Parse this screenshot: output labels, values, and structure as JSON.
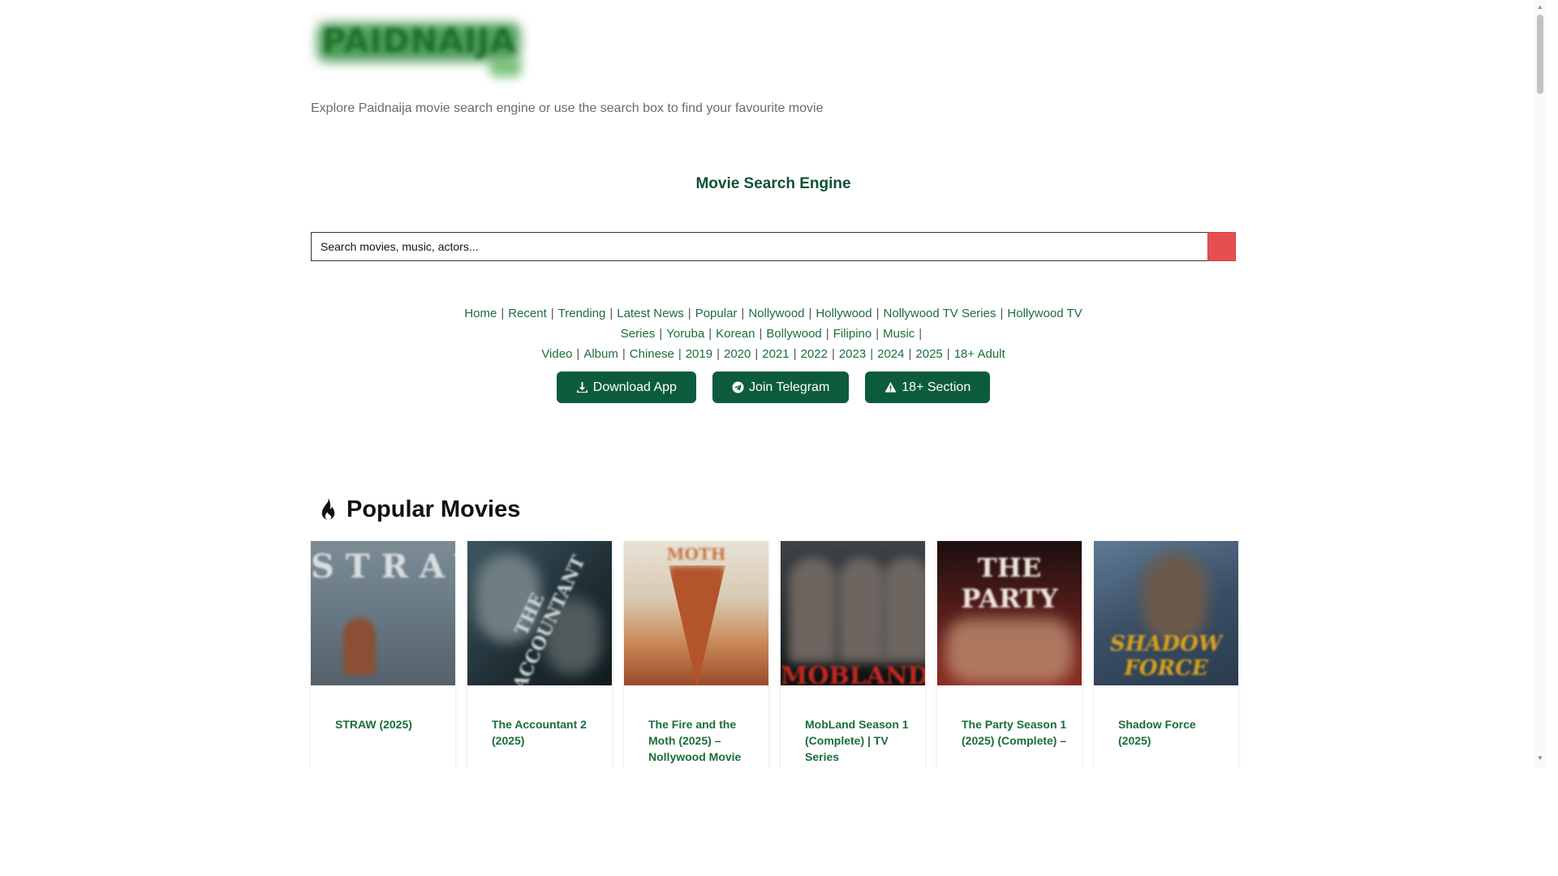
{
  "header": {
    "tagline": "Explore Paidnaija movie search engine or use the search box to find your favourite movie",
    "engine_title": "Movie Search Engine"
  },
  "search": {
    "placeholder": "Search movies, music, actors..."
  },
  "nav": {
    "row1": [
      "Home",
      "Recent",
      "Trending",
      "Latest News",
      "Popular",
      "Nollywood",
      "Hollywood",
      "Nollywood TV Series",
      "Hollywood TV Series",
      "Yoruba",
      "Korean",
      "Bollywood",
      "Filipino",
      "Music"
    ],
    "row2": [
      "Video",
      "Album",
      "Chinese",
      "2019",
      "2020",
      "2021",
      "2022",
      "2023",
      "2024",
      "2025",
      "18+ Adult"
    ]
  },
  "buttons": {
    "download": "Download App",
    "telegram": "Join Telegram",
    "adult": "18+ Section"
  },
  "popular": {
    "title": "Popular Movies",
    "movies": [
      {
        "title": "STRAW (2025)"
      },
      {
        "title": "The Accountant 2 (2025)"
      },
      {
        "title": "The Fire and the Moth (2025) – Nollywood Movie"
      },
      {
        "title": "MobLand Season 1 (Complete) | TV Series"
      },
      {
        "title": "The Party Season 1 (2025) (Complete) –"
      },
      {
        "title": "Shadow Force (2025)"
      }
    ]
  },
  "colors": {
    "brand_green": "#0d5b3d",
    "link_green": "#1b6e3a",
    "search_button_red": "#e45050"
  }
}
